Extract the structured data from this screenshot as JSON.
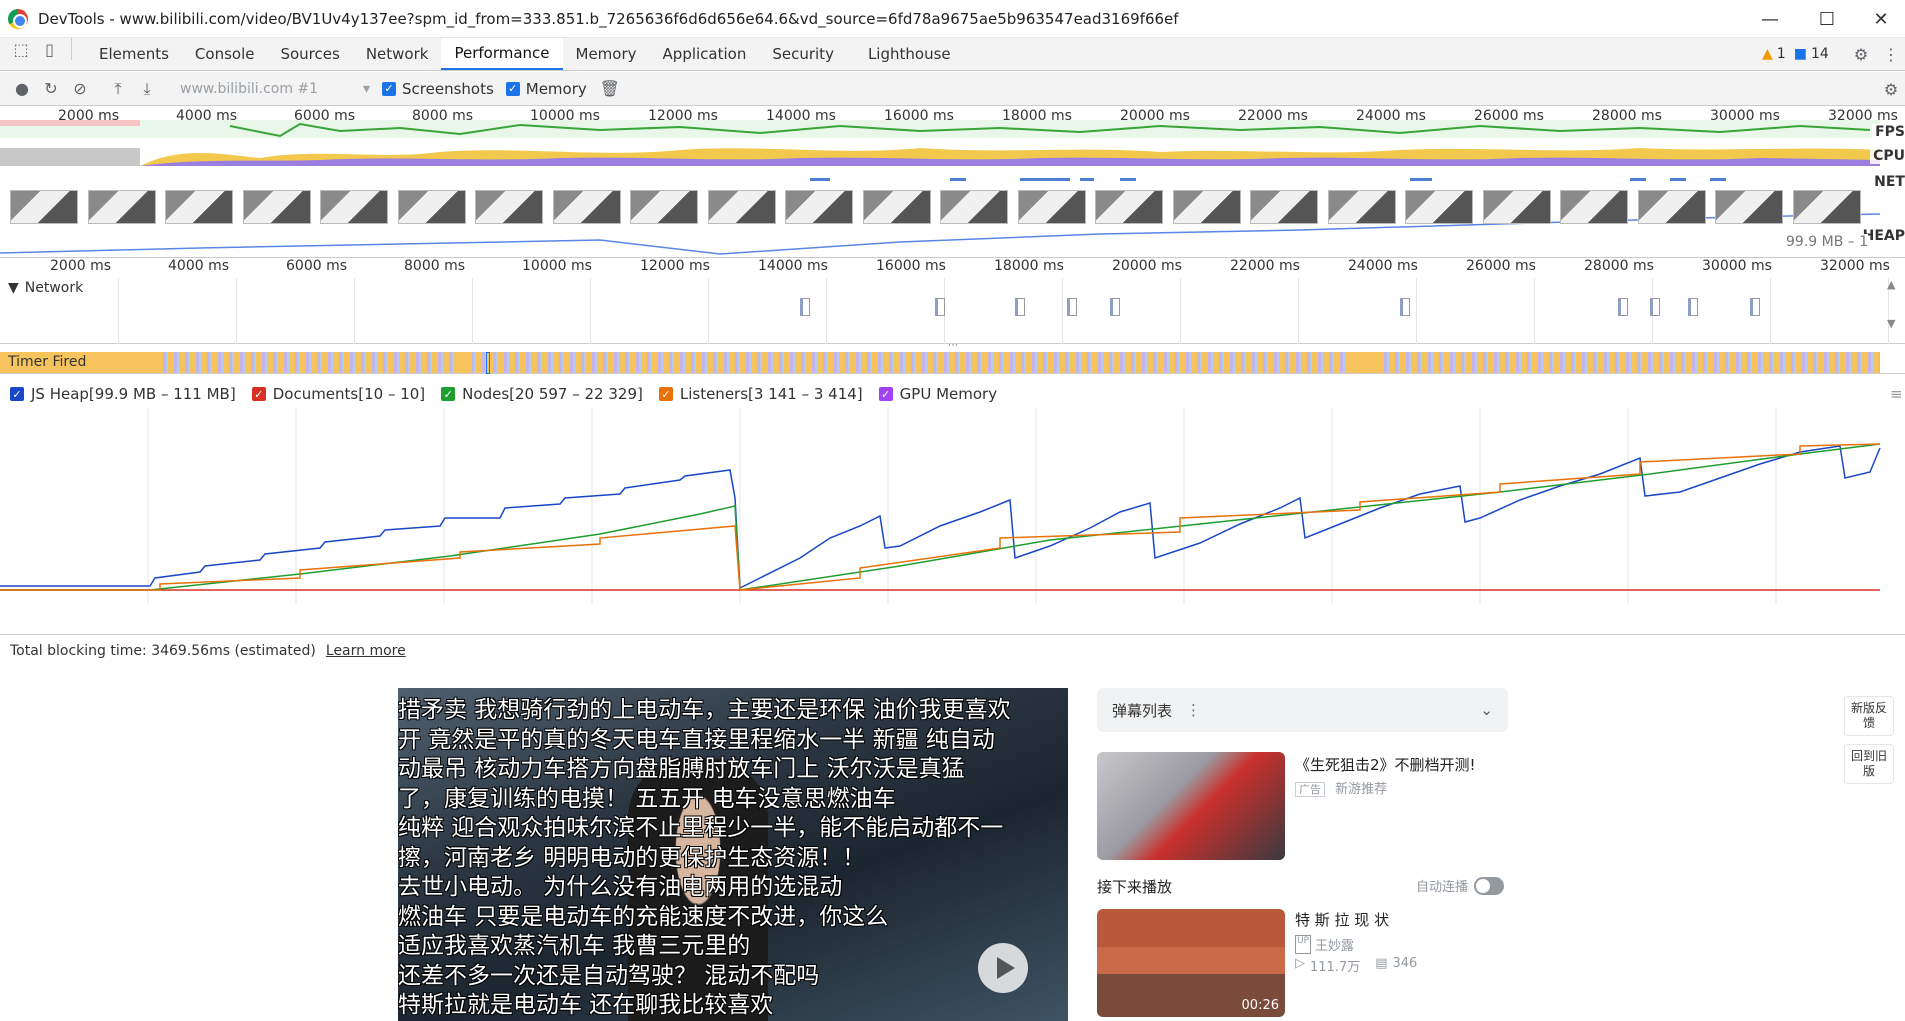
{
  "window": {
    "title": "DevTools - www.bilibili.com/video/BV1Uv4y137ee?spm_id_from=333.851.b_7265636f6d6d656e64.6&vd_source=6fd78a9675ae5b963547ead3169f66ef",
    "minimize": "—",
    "maximize": "☐",
    "close": "✕"
  },
  "devtools": {
    "tabs": [
      "Elements",
      "Console",
      "Sources",
      "Network",
      "Performance",
      "Memory",
      "Application",
      "Security",
      "Lighthouse"
    ],
    "active_tab": "Performance",
    "warnings_count": "1",
    "messages_count": "14"
  },
  "perf_toolbar": {
    "profile_select": "www.bilibili.com #1",
    "screenshots_label": "Screenshots",
    "memory_label": "Memory"
  },
  "overview": {
    "ticks": [
      "2000 ms",
      "4000 ms",
      "6000 ms",
      "8000 ms",
      "10000 ms",
      "12000 ms",
      "14000 ms",
      "16000 ms",
      "18000 ms",
      "20000 ms",
      "22000 ms",
      "24000 ms",
      "26000 ms",
      "28000 ms",
      "30000 ms",
      "32000 ms"
    ],
    "fps_label": "FPS",
    "cpu_label": "CPU",
    "net_label": "NET",
    "heap_label": "HEAP",
    "heap_range": "99.9 MB – 1"
  },
  "network_track": {
    "label": "Network"
  },
  "main_strip": {
    "label": "Timer Fired"
  },
  "memory_legend": [
    {
      "label": "JS Heap[99.9 MB – 111 MB]",
      "color": "#1a47c8"
    },
    {
      "label": "Documents[10 – 10]",
      "color": "#d93025"
    },
    {
      "label": "Nodes[20 597 – 22 329]",
      "color": "#1e9e2e"
    },
    {
      "label": "Listeners[3 141 – 3 414]",
      "color": "#e8710a"
    },
    {
      "label": "GPU Memory",
      "color": "#a142f4"
    }
  ],
  "summary": {
    "text": "Total blocking time: 3469.56ms (estimated)",
    "link": "Learn more"
  },
  "page": {
    "danmaku": [
      "措矛卖 我想骑行劲的上电动车，主要还是环保  油价我更喜欢",
      "开  竟然是平的真的冬天电车直接里程缩水一半  新疆  纯自动",
      "动最吊    核动力车搭方向盘脂膊肘放车门上    沃尔沃是真猛",
      "了，康复训练的电摸！     五五开       电车没意思燃油车",
      "纯粹 迎合观众拍味尔滨不止里程少一半，能不能启动都不一",
      "   擦，河南老乡            明明电动的更保护生态资源！！",
      "            去世小电动。   为什么没有油电两用的选混动",
      " 燃油车                只要是电动车的充能速度不改进，你这么",
      "适应我喜欢蒸汽机车                   我曹三元里的",
      "还差不多一次还是自动驾驶？                混动不配吗",
      "特斯拉就是电动车                          还在聊我比较喜欢"
    ],
    "danmaku_list_label": "弹幕列表",
    "ad_card": {
      "title": "《生死狙击2》不删档开测!",
      "tag": "广告",
      "source": "新游推荐"
    },
    "up_next_label": "接下来播放",
    "autoplay_label": "自动连播",
    "next_card": {
      "title": "特 斯 拉 现 状",
      "author": "王妙露",
      "views": "111.7万",
      "danmaku_count": "346",
      "duration": "00:26"
    },
    "rail": [
      "新版反馈",
      "回到旧版"
    ]
  }
}
